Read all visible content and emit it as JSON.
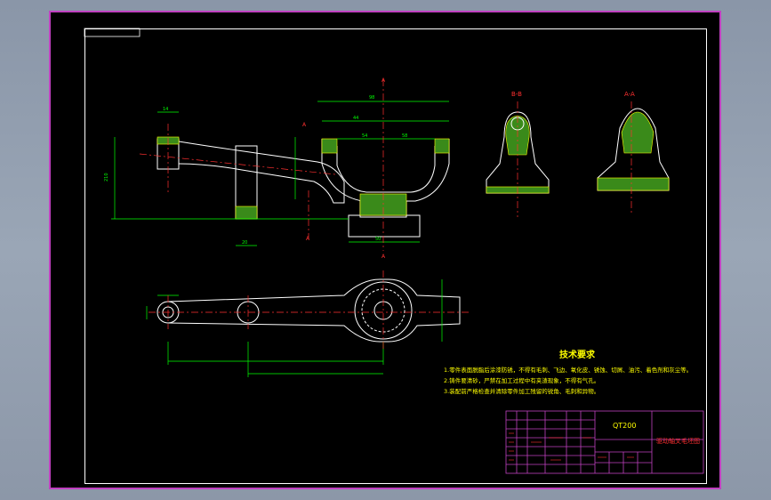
{
  "drawing": {
    "section_labels": [
      "B-B",
      "A-A"
    ],
    "cut_marker": "A",
    "dimension_labels": [
      "98",
      "44",
      "54",
      "58",
      "50",
      "20",
      "14",
      "210"
    ],
    "notes_title": "技术要求",
    "notes": [
      "1.零件表面脱脂后涂漆防锈，不得有毛刺、飞边、氧化皮、锈蚀、切屑、油污、着色剂和灰尘等。",
      "2.铸件要清砂，严禁在加工过程中有夹渣现象，不得有气孔。",
      "3.装配前严格检查并清除零件加工残留的锐角、毛刺和异物。"
    ]
  },
  "title_block": {
    "material": "QT200",
    "part_name": "驱动轴叉毛坯图"
  },
  "colors": {
    "background": "#000000",
    "frame": "#ffffff",
    "outline": "#ffffff",
    "dimension": "#00ff00",
    "center_line": "#ff3030",
    "hatch": "#ffff00",
    "section_fill": "#00c000",
    "title_block": "#c040c0"
  }
}
